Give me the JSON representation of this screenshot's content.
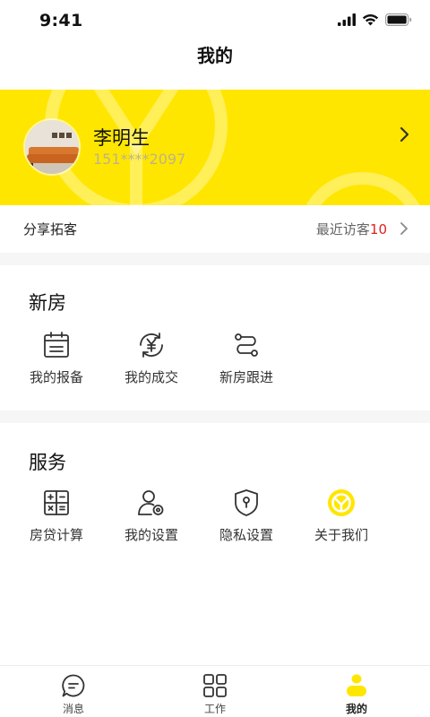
{
  "status_bar": {
    "time": "9:41"
  },
  "header": {
    "title": "我的"
  },
  "profile": {
    "name": "李明生",
    "phone": "151****2097"
  },
  "share_row": {
    "label": "分享拓客",
    "visitor_label": "最近访客",
    "visitor_count": "10"
  },
  "new_house": {
    "title": "新房",
    "items": [
      {
        "label": "我的报备",
        "icon": "calendar-icon"
      },
      {
        "label": "我的成交",
        "icon": "yuan-cycle-icon"
      },
      {
        "label": "新房跟进",
        "icon": "route-icon"
      }
    ]
  },
  "service": {
    "title": "服务",
    "items": [
      {
        "label": "房贷计算",
        "icon": "calculator-icon"
      },
      {
        "label": "我的设置",
        "icon": "user-settings-icon"
      },
      {
        "label": "隐私设置",
        "icon": "privacy-shield-icon"
      },
      {
        "label": "关于我们",
        "icon": "brand-logo-icon"
      }
    ]
  },
  "tab_bar": {
    "items": [
      {
        "label": "消息",
        "icon": "message-icon",
        "active": false
      },
      {
        "label": "工作",
        "icon": "grid-apps-icon",
        "active": false
      },
      {
        "label": "我的",
        "icon": "person-icon",
        "active": true
      }
    ]
  },
  "colors": {
    "brand_yellow": "#FFE600",
    "accent_red": "#E02020",
    "section_gap": "#F6F6F6"
  }
}
